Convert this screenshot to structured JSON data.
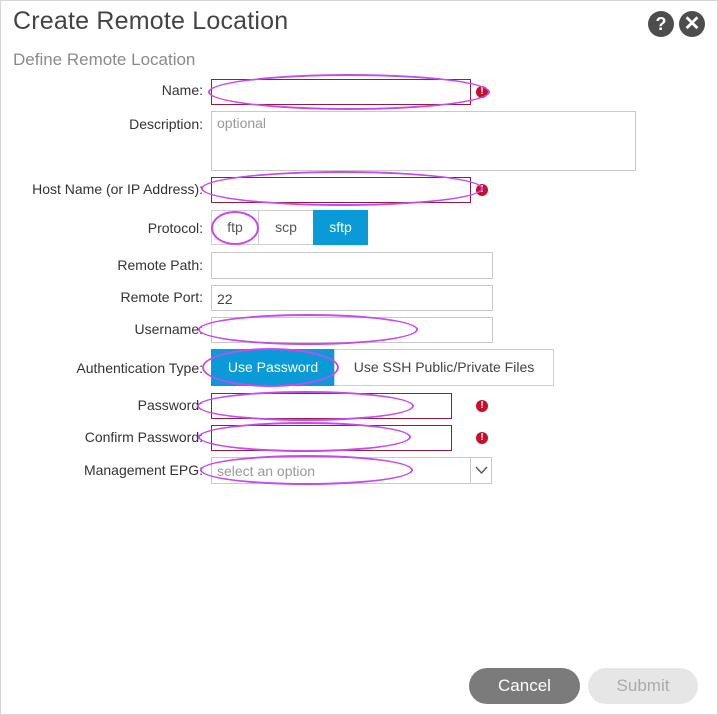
{
  "dialog": {
    "title": "Create Remote Location",
    "subtitle": "Define Remote Location",
    "help_icon": "?",
    "close_icon": "✕"
  },
  "form": {
    "name_label": "Name:",
    "name_value": "",
    "description_label": "Description:",
    "description_placeholder": "optional",
    "host_label": "Host Name (or IP Address):",
    "host_value": "",
    "protocol_label": "Protocol:",
    "protocol_options": [
      "ftp",
      "scp",
      "sftp"
    ],
    "protocol_selected": "sftp",
    "remote_path_label": "Remote Path:",
    "remote_path_value": "",
    "remote_port_label": "Remote Port:",
    "remote_port_value": "22",
    "username_label": "Username:",
    "username_value": "",
    "auth_type_label": "Authentication Type:",
    "auth_options": [
      "Use Password",
      "Use SSH Public/Private Files"
    ],
    "auth_selected": "Use Password",
    "password_label": "Password:",
    "password_value": "",
    "confirm_password_label": "Confirm Password:",
    "confirm_password_value": "",
    "mgmt_epg_label": "Management EPG:",
    "mgmt_epg_placeholder": "select an option"
  },
  "footer": {
    "cancel_label": "Cancel",
    "submit_label": "Submit"
  },
  "colors": {
    "accent": "#0a9ad8",
    "error": "#c9102b",
    "annotation": "#c64af0"
  }
}
